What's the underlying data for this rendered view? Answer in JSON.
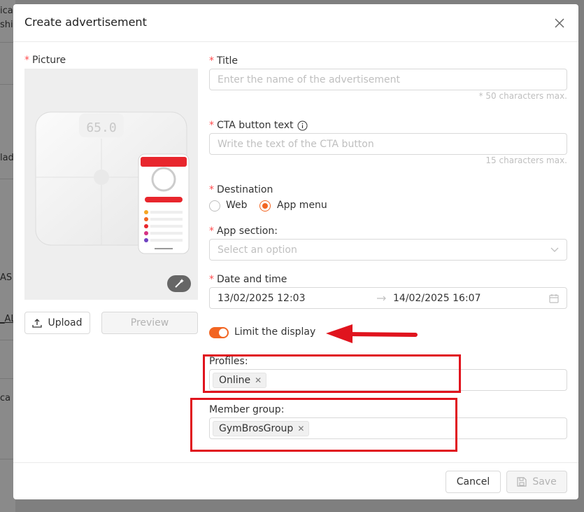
{
  "background": {
    "fragments": [
      "ica",
      "shi",
      "lad",
      "AS",
      "_AL",
      "ca"
    ]
  },
  "modal": {
    "title": "Create advertisement",
    "close_icon": "close-icon"
  },
  "picture": {
    "label": "Picture",
    "upload_label": "Upload",
    "preview_label": "Preview",
    "magic_icon": "magic-wand-icon",
    "scale_display": "65.0"
  },
  "title_field": {
    "label": "Title",
    "placeholder": "Enter the name of the advertisement",
    "hint": "* 50 characters max."
  },
  "cta_field": {
    "label": "CTA button text",
    "placeholder": "Write the text of the CTA button",
    "hint": "15 characters max."
  },
  "destination": {
    "label": "Destination",
    "options": [
      {
        "label": "Web",
        "checked": false
      },
      {
        "label": "App menu",
        "checked": true
      }
    ]
  },
  "app_section": {
    "label": "App section:",
    "placeholder": "Select an option"
  },
  "date_time": {
    "label": "Date and time",
    "start": "13/02/2025 12:03",
    "end": "14/02/2025 16:07"
  },
  "limit_display": {
    "label": "Limit the display",
    "enabled": true
  },
  "profiles": {
    "label": "Profiles:",
    "tags": [
      "Online"
    ]
  },
  "member_group": {
    "label": "Member group:",
    "tags": [
      "GymBrosGroup"
    ]
  },
  "footer": {
    "cancel_label": "Cancel",
    "save_label": "Save"
  },
  "colors": {
    "accent": "#f26522",
    "required": "#ff4d4f",
    "annotation_red": "#e0141e"
  }
}
